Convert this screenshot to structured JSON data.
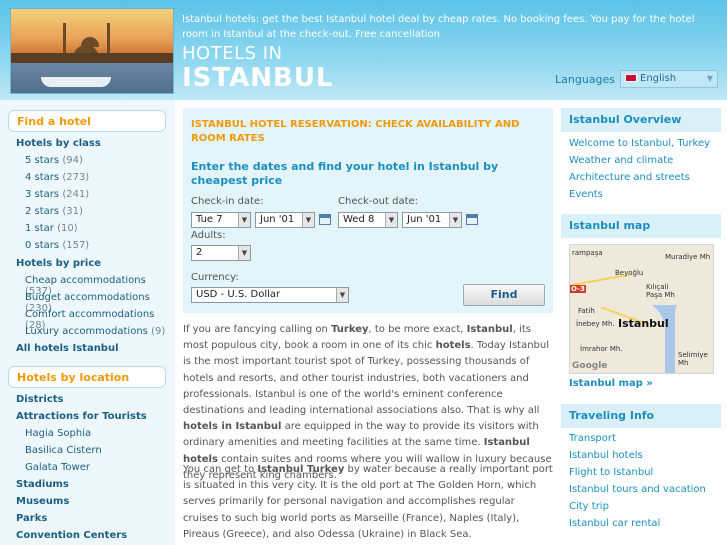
{
  "header": {
    "tagline": "Istanbul hotels: get the best Istanbul hotel deal by cheap rates. No booking fees. You pay for the hotel room in Istanbul at the check-out. Free cancellation",
    "title_line1": "HOTELS IN",
    "title_line2": "ISTANBUL",
    "languages_label": "Languages",
    "language_selected": "English"
  },
  "left": {
    "find_hotel": "Find a hotel",
    "by_class": "Hotels by class",
    "classes": [
      {
        "label": "5 stars",
        "count": "(94)"
      },
      {
        "label": "4 stars",
        "count": "(273)"
      },
      {
        "label": "3 stars",
        "count": "(241)"
      },
      {
        "label": "2 stars",
        "count": "(31)"
      },
      {
        "label": "1 star",
        "count": "(10)"
      },
      {
        "label": "0 stars",
        "count": "(157)"
      }
    ],
    "by_price": "Hotels by price",
    "prices": [
      {
        "label": "Cheap accommodations",
        "count": "(537)"
      },
      {
        "label": "Budget accommodations",
        "count": "(230)"
      },
      {
        "label": "Comfort accommodations",
        "count": "(28)"
      },
      {
        "label": "Luxury accommodations",
        "count": "(9)"
      }
    ],
    "all_hotels": "All hotels Istanbul",
    "by_location": "Hotels by location",
    "districts": "Districts",
    "attractions": "Attractions for Tourists",
    "attraction_items": [
      "Hagia Sophia",
      "Basilica Cistern",
      "Galata Tower"
    ],
    "stadiums": "Stadiums",
    "museums": "Museums",
    "parks": "Parks",
    "convention": "Convention Centers"
  },
  "reservation": {
    "title": "ISTANBUL HOTEL RESERVATION: CHECK AVAILABILITY AND ROOM RATES",
    "subtitle": "Enter the dates and find your hotel in Istanbul by cheapest price",
    "checkin_label": "Check-in date:",
    "checkout_label": "Check-out date:",
    "checkin_day": "Tue 7",
    "checkin_month": "Jun '01",
    "checkout_day": "Wed 8",
    "checkout_month": "Jun '01",
    "adults_label": "Adults:",
    "adults_value": "2",
    "currency_label": "Currency:",
    "currency_value": "USD - U.S. Dollar",
    "find_button": "Find"
  },
  "content": {
    "p1": [
      {
        "t": "If you are fancying calling on "
      },
      {
        "b": "Turkey"
      },
      {
        "t": ", to be more exact, "
      },
      {
        "b": "Istanbul"
      },
      {
        "t": ", its most populous city, book a room in one of its chic "
      },
      {
        "b": "hotels"
      },
      {
        "t": ". Today Istanbul is the most important tourist spot of Turkey, possessing thousands of hotels and resorts, and other tourist industries, both vacationers and professionals. Istanbul is one of the world's eminent conference destinations and leading international associations also. That is why all "
      },
      {
        "b": "hotels in Istanbul"
      },
      {
        "t": " are equipped in the way to provide its visitors with ordinary amenities and meeting facilities at the same time. "
      },
      {
        "b": "Istanbul hotels"
      },
      {
        "t": " contain suites and rooms where you will wallow in luxury because they represent king chambers."
      }
    ],
    "p2": [
      {
        "t": "You can get to "
      },
      {
        "b": "Istanbul Turkey"
      },
      {
        "t": " by water because a really important port is situated in this very city. It is the old port at The Golden Horn, which serves primarily for personal navigation and accomplishes regular cruises to such big world ports as Marseille (France), Naples (Italy), Pireaus (Greece), and also Odessa (Ukraine) in Black Sea."
      }
    ]
  },
  "right": {
    "overview": "Istanbul Overview",
    "overview_links": [
      "Welcome to Istanbul, Turkey",
      "Weather and climate",
      "Architecture and streets",
      "Events"
    ],
    "map_head": "Istanbul map",
    "map_labels": {
      "a": "rampaşa",
      "b": "Beyoğlu",
      "c": "Muradiye Mh",
      "d": "Kılıçali Paşa Mh",
      "e": "Fatih",
      "f": "İnebey Mh.",
      "g": "Istanbul",
      "h": "İmrahor Mh.",
      "i": "Selimiye Mh",
      "j": "O-3",
      "google": "Google"
    },
    "map_link": "Istanbul map »",
    "traveling": "Traveling Info",
    "travel_links": [
      "Transport",
      "Istanbul hotels",
      "Flight to Istanbul",
      "Istanbul tours and vacation",
      "City trip",
      "Istanbul car rental"
    ]
  }
}
